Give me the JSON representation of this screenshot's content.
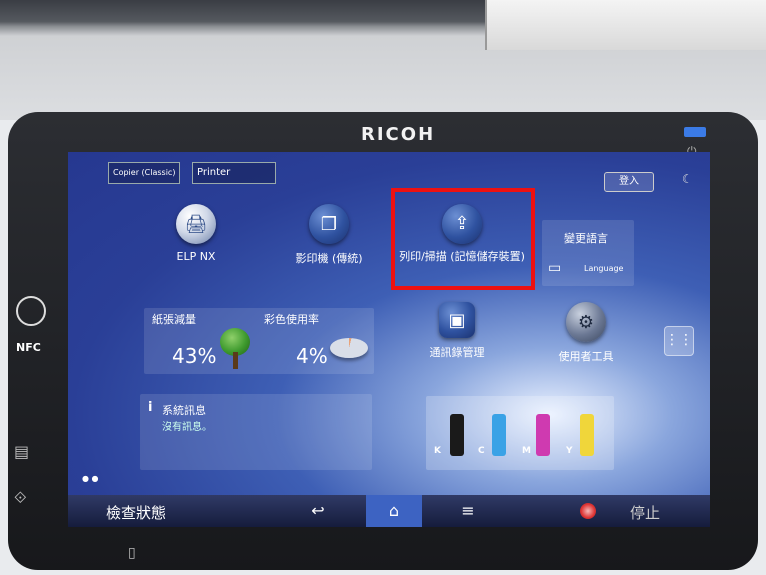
{
  "device": {
    "brand": "RICOH",
    "nfc_label": "NFC"
  },
  "tabs": [
    "Copier (Classic)",
    "Printer"
  ],
  "header": {
    "login_label": "登入"
  },
  "apps": [
    {
      "label": "ELP NX",
      "icon": "elp-nx-icon"
    },
    {
      "label": "影印機 (傳統)",
      "icon": "copier-icon"
    },
    {
      "label": "列印/掃描 (記憶儲存裝置)",
      "icon": "usb-storage-icon"
    },
    {
      "label": "通訊錄管理",
      "icon": "address-book-icon"
    },
    {
      "label": "使用者工具",
      "icon": "gear-icon"
    }
  ],
  "language": {
    "title": "變更語言",
    "label": "Language"
  },
  "eco": {
    "paper_label": "紙張減量",
    "paper_value": "43%",
    "color_label": "彩色使用率",
    "color_value": "4%"
  },
  "system": {
    "title": "系統訊息",
    "message": "沒有訊息。"
  },
  "toner": [
    {
      "letter": "K",
      "color": "#1a1a1a"
    },
    {
      "letter": "C",
      "color": "#3aa2e6"
    },
    {
      "letter": "M",
      "color": "#cf3ab0"
    },
    {
      "letter": "Y",
      "color": "#f0d63a"
    }
  ],
  "bottom": {
    "check_status": "檢查狀態",
    "stop": "停止"
  },
  "colors": {
    "highlight": "#ee1111",
    "screen": "#2a3f97",
    "home_active": "#3d63c2"
  }
}
